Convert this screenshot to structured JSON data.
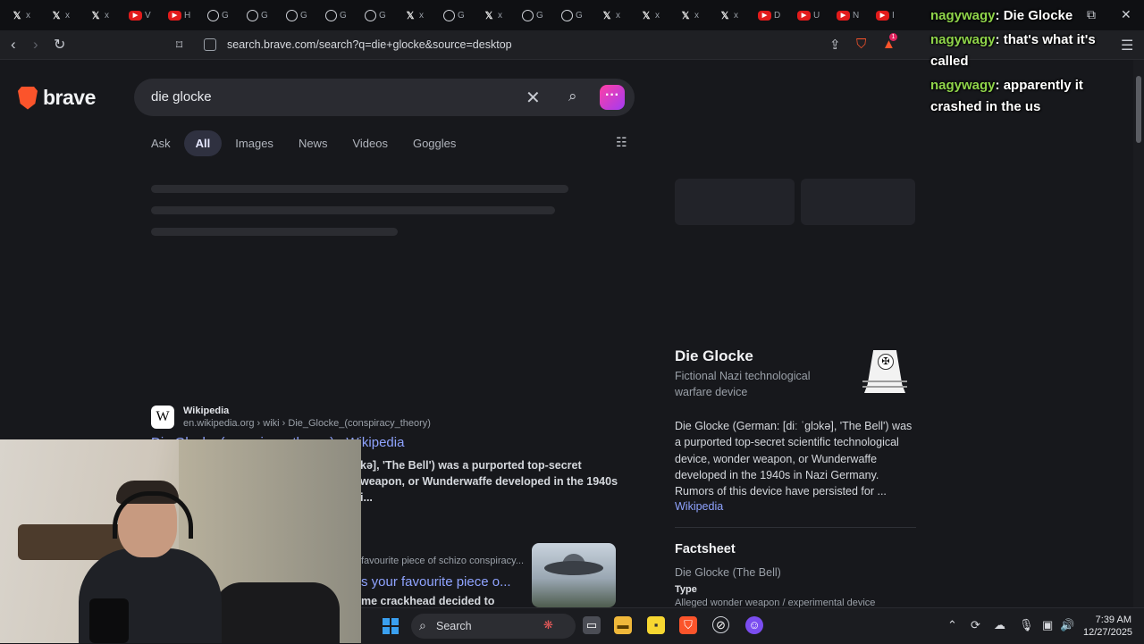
{
  "browser": {
    "tabs": [
      {
        "icon": "x-icon",
        "glyph": "𝕏",
        "text": "x"
      },
      {
        "icon": "x-icon",
        "glyph": "𝕏",
        "text": "x"
      },
      {
        "icon": "x-icon",
        "glyph": "𝕏",
        "text": "x"
      },
      {
        "icon": "youtube-icon",
        "glyph": "▶",
        "text": "V"
      },
      {
        "icon": "youtube-icon",
        "glyph": "▶",
        "text": "H"
      },
      {
        "icon": "grok-icon",
        "glyph": "⊘",
        "text": "G"
      },
      {
        "icon": "grok-icon",
        "glyph": "⊘",
        "text": "G"
      },
      {
        "icon": "grok-icon",
        "glyph": "⊘",
        "text": "G"
      },
      {
        "icon": "grok-icon",
        "glyph": "⊘",
        "text": "G"
      },
      {
        "icon": "grok-icon",
        "glyph": "⊘",
        "text": "G"
      },
      {
        "icon": "x-icon",
        "glyph": "𝕏",
        "text": "x"
      },
      {
        "icon": "grok-icon",
        "glyph": "⊘",
        "text": "G"
      },
      {
        "icon": "x-icon",
        "glyph": "𝕏",
        "text": "x"
      },
      {
        "icon": "grok-icon",
        "glyph": "⊘",
        "text": "G"
      },
      {
        "icon": "grok-icon",
        "glyph": "⊘",
        "text": "G"
      },
      {
        "icon": "x-icon",
        "glyph": "𝕏",
        "text": "x"
      },
      {
        "icon": "x-icon",
        "glyph": "𝕏",
        "text": "x"
      },
      {
        "icon": "x-icon",
        "glyph": "𝕏",
        "text": "x"
      },
      {
        "icon": "x-icon",
        "glyph": "𝕏",
        "text": "x"
      },
      {
        "icon": "youtube-icon",
        "glyph": "▶",
        "text": "D"
      },
      {
        "icon": "youtube-icon",
        "glyph": "▶",
        "text": "U"
      },
      {
        "icon": "youtube-icon",
        "glyph": "▶",
        "text": "N"
      },
      {
        "icon": "youtube-icon",
        "glyph": "▶",
        "text": "I"
      }
    ],
    "url": "search.brave.com/search?q=die+glocke&source=desktop",
    "rewards_badge": "1"
  },
  "search": {
    "brand": "brave",
    "query": "die glocke",
    "tabs": [
      "Ask",
      "All",
      "Images",
      "News",
      "Videos",
      "Goggles"
    ],
    "active_tab": "All"
  },
  "results": [
    {
      "site": "Wikipedia",
      "path": "en.wikipedia.org › wiki › Die_Glocke_(conspiracy_theory)",
      "title": "Die Glocke (conspiracy theory) - Wikipedia",
      "desc": "kə], 'The Bell') was a purported top-secret weapon, or Wunderwaffe developed in the 1940s i..."
    },
    {
      "meta": "favourite piece of schizo conspiracy...",
      "title": "s your favourite piece o...",
      "desc": "me crackhead decided to"
    }
  ],
  "knowledge_panel": {
    "title": "Die Glocke",
    "subtitle": "Fictional Nazi technological warfare device",
    "description": "Die Glocke (German: [diː ˈɡlɔkə], 'The Bell') was a purported top-secret scientific technological device, wonder weapon, or Wunderwaffe developed in the 1940s in Nazi Germany. Rumors of this device have persisted for ...",
    "source_link": "Wikipedia",
    "factsheet_title": "Factsheet",
    "factsheet_sub": "Die Glocke (The Bell)",
    "type_label": "Type",
    "type_value": "Alleged wonder weapon / experimental device"
  },
  "chat": [
    {
      "user": "nagywagy",
      "message": "Die Glocke"
    },
    {
      "user": "nagywagy",
      "message": "that's what it's called"
    },
    {
      "user": "nagywagy",
      "message": "apparently it crashed in the us"
    }
  ],
  "taskbar": {
    "search_label": "Search",
    "time": "7:39 AM",
    "date": "12/27/2025"
  }
}
